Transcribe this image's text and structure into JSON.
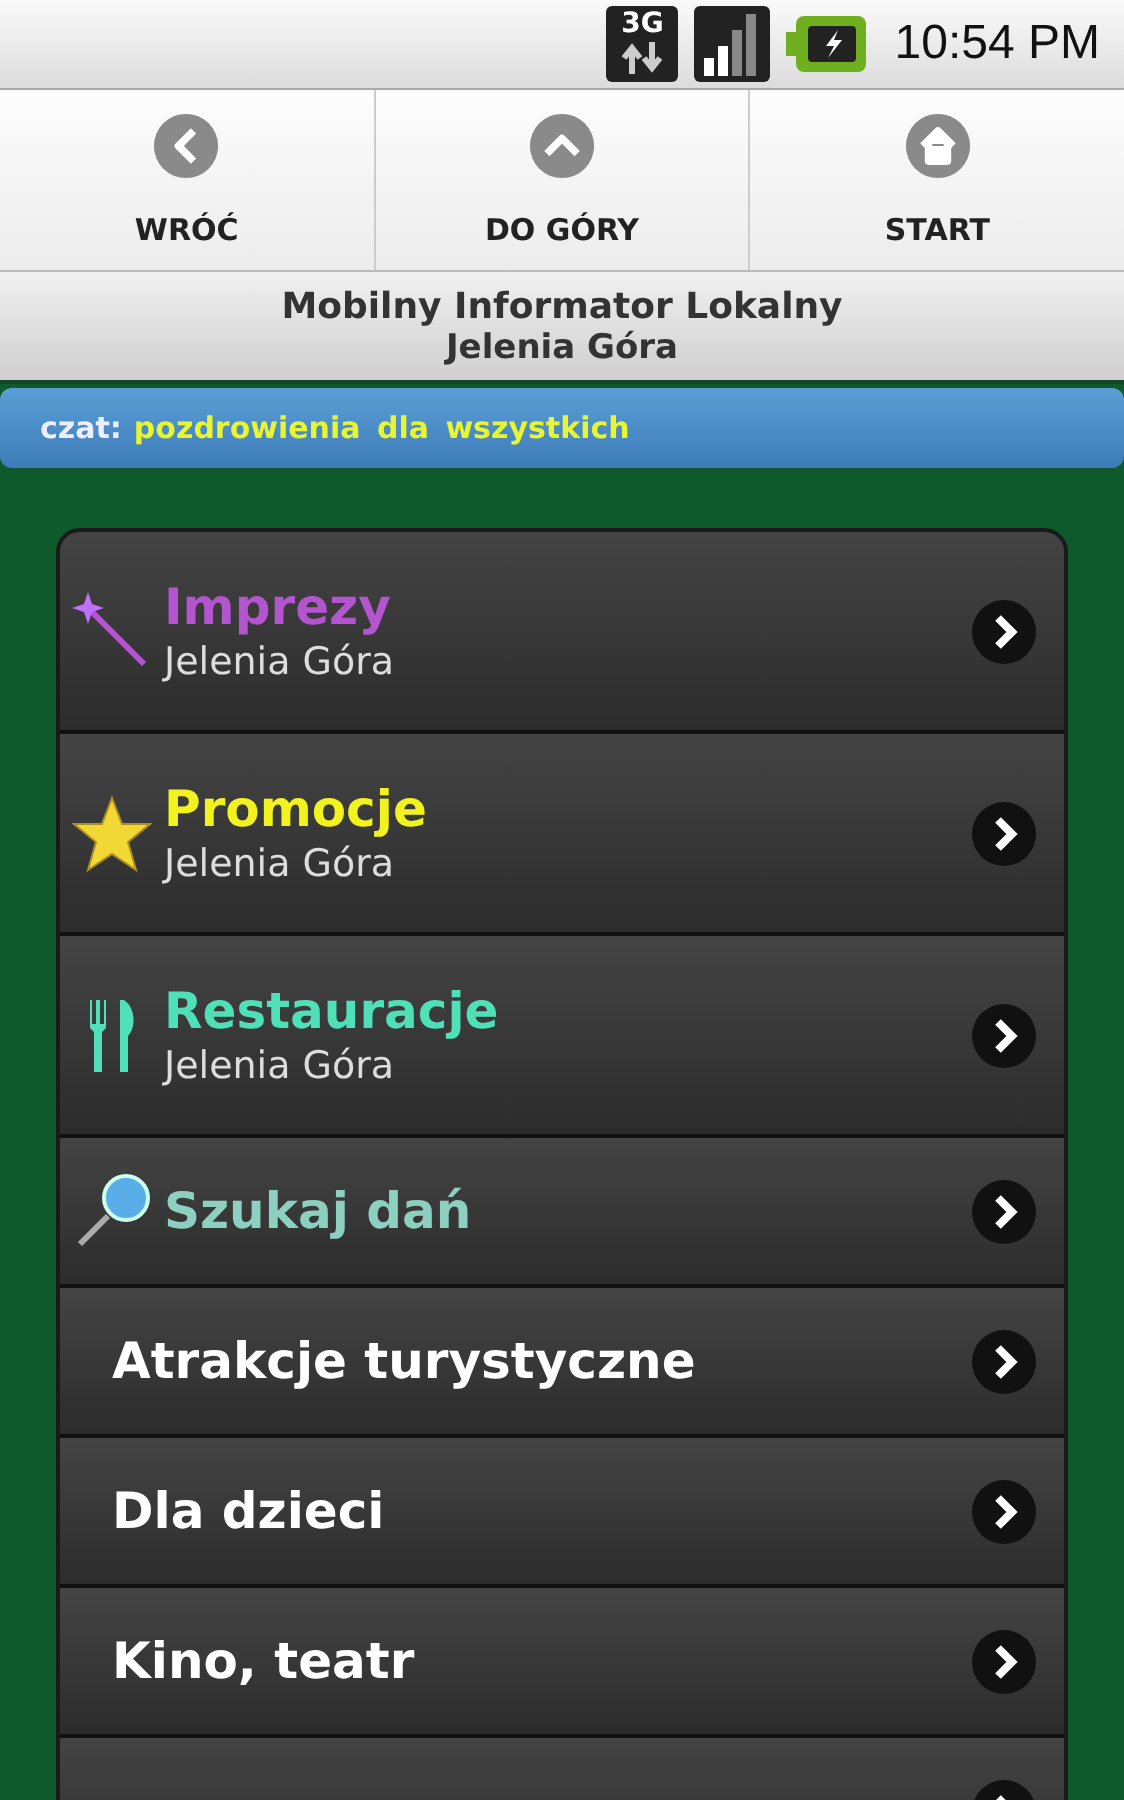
{
  "status_bar": {
    "network": "3G",
    "time": "10:54 PM"
  },
  "nav": [
    {
      "label": "WRÓĆ",
      "kind": "back"
    },
    {
      "label": "DO GÓRY",
      "kind": "up"
    },
    {
      "label": "START",
      "kind": "home"
    }
  ],
  "header": {
    "title": "Mobilny Informator Lokalny",
    "subtitle": "Jelenia Góra"
  },
  "chat": {
    "label": "czat:",
    "message": "pozdrowienia dla wszystkich"
  },
  "menu": [
    {
      "kind": "wand",
      "title": "Imprezy",
      "subtitle": "Jelenia Góra",
      "color": "#b455d0"
    },
    {
      "kind": "star",
      "title": "Promocje",
      "subtitle": "Jelenia Góra",
      "color": "#f2f21e"
    },
    {
      "kind": "cutlery",
      "title": "Restauracje",
      "subtitle": "Jelenia Góra",
      "color": "#50e0b8"
    },
    {
      "kind": "magnifier",
      "title": "Szukaj dań",
      "color": "#8ed0c0"
    },
    {
      "kind": "plain",
      "title": "Atrakcje turystyczne",
      "color": "#ffffff"
    },
    {
      "kind": "plain",
      "title": "Dla dzieci",
      "color": "#ffffff"
    },
    {
      "kind": "plain",
      "title": "Kino, teatr",
      "color": "#ffffff"
    },
    {
      "kind": "cut"
    }
  ]
}
